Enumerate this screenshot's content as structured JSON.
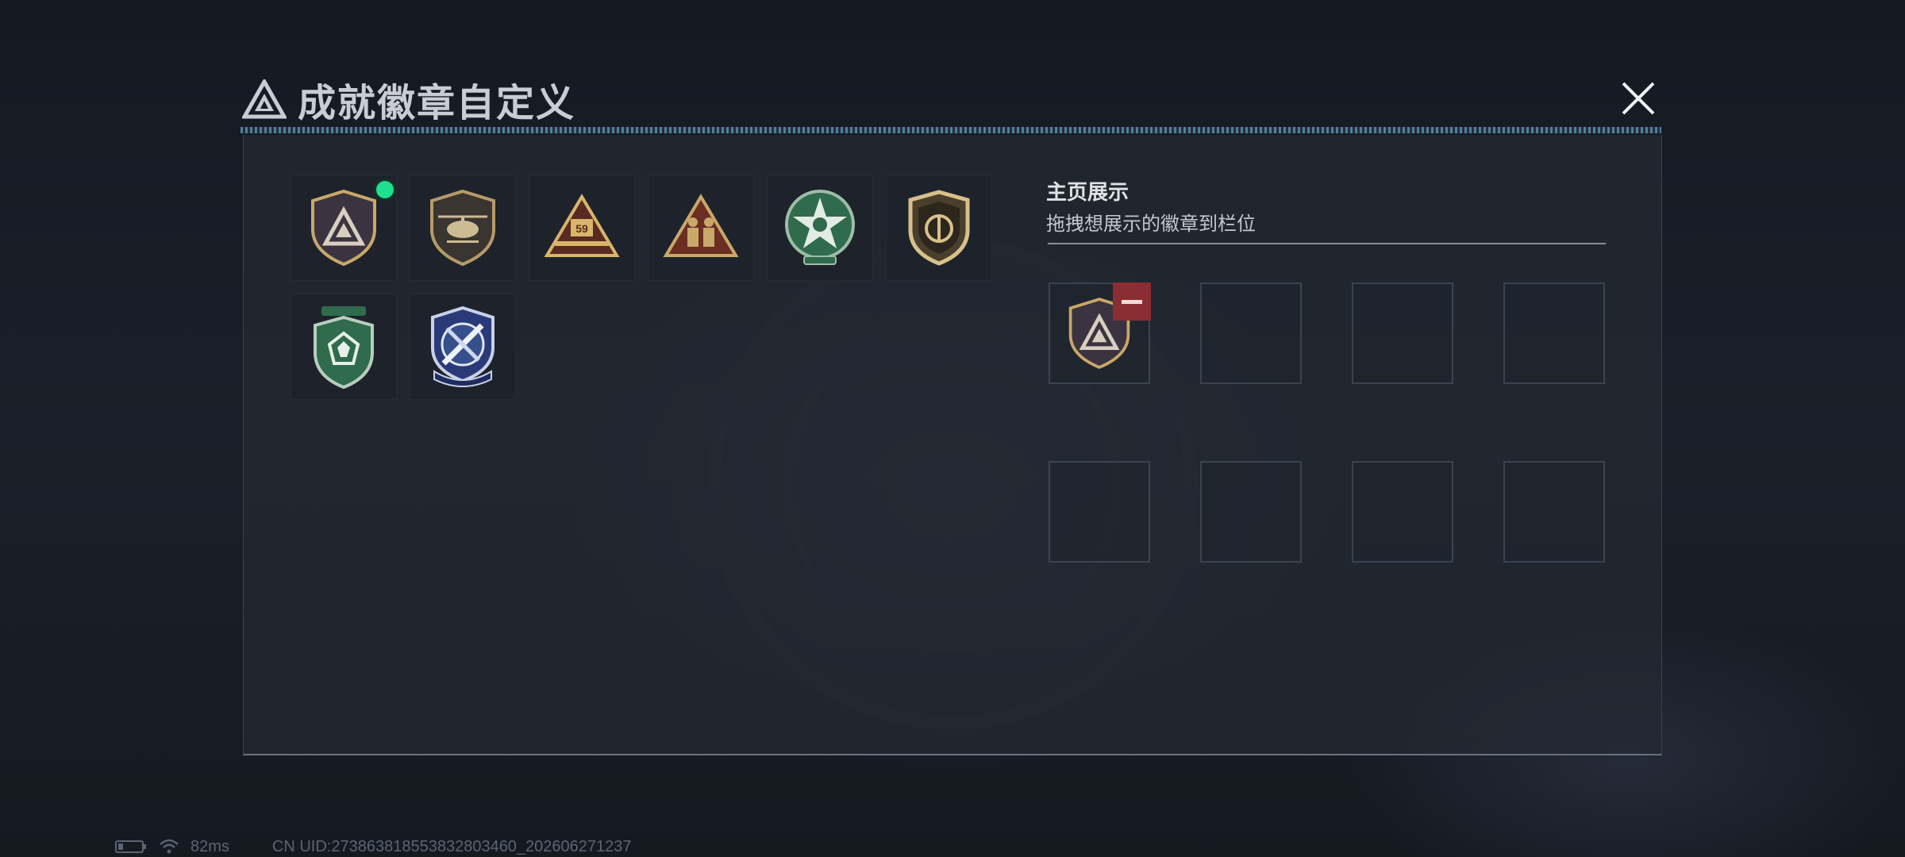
{
  "window": {
    "title": "成就徽章自定义",
    "close_icon": "close-icon"
  },
  "badges": [
    {
      "name": "triangle-emblem-badge",
      "new": true
    },
    {
      "name": "helicopter-badge",
      "new": false
    },
    {
      "name": "rank-59-badge",
      "new": false
    },
    {
      "name": "soldiers-triangle-badge",
      "new": false
    },
    {
      "name": "green-star-badge",
      "new": false
    },
    {
      "name": "gold-shield-badge",
      "new": false
    },
    {
      "name": "green-gem-shield-badge",
      "new": false
    },
    {
      "name": "blue-blades-badge",
      "new": false
    }
  ],
  "showcase": {
    "title": "主页展示",
    "subtitle": "拖拽想展示的徽章到栏位",
    "slots": [
      {
        "badge": "triangle-emblem-badge"
      },
      {
        "badge": ""
      },
      {
        "badge": ""
      },
      {
        "badge": ""
      },
      {
        "badge": ""
      },
      {
        "badge": ""
      },
      {
        "badge": ""
      },
      {
        "badge": ""
      }
    ]
  },
  "status": {
    "ping": "82ms",
    "uid": "CN UID:273863818553832803460_202606271237"
  },
  "colors": {
    "new_dot": "#1fe08f",
    "remove": "#8a2e33",
    "gold": "#c9a86a",
    "green": "#2f6b4c",
    "navy": "#2a3a78"
  }
}
